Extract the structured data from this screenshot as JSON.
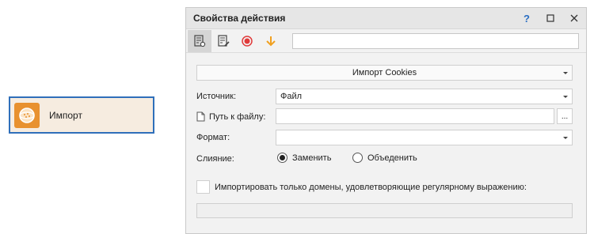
{
  "action_block": {
    "label": "Импорт",
    "icon": "cookie-icon",
    "accent": "#e8912f",
    "border": "#2f6fba"
  },
  "panel": {
    "title": "Свойства действия",
    "title_buttons": {
      "help": "?",
      "maximize": "□",
      "close": "✕"
    },
    "toolbar": {
      "icons": [
        "settings-doc-icon",
        "edit-doc-icon",
        "record-icon",
        "arrow-down-icon"
      ],
      "input_value": ""
    },
    "action_select": "Импорт Cookies",
    "source": {
      "label": "Источник:",
      "value": "Файл"
    },
    "file_path": {
      "label": "Путь к файлу:",
      "value": "",
      "browse": "..."
    },
    "format": {
      "label": "Формат:",
      "value": ""
    },
    "merge": {
      "label": "Слияние:",
      "options": [
        {
          "label": "Заменить",
          "selected": true
        },
        {
          "label": "Объеденить",
          "selected": false
        }
      ]
    },
    "domain_filter": {
      "label": "Импортировать только домены, удовлетворяющие регулярному выражению:",
      "checked": false,
      "value": ""
    }
  }
}
